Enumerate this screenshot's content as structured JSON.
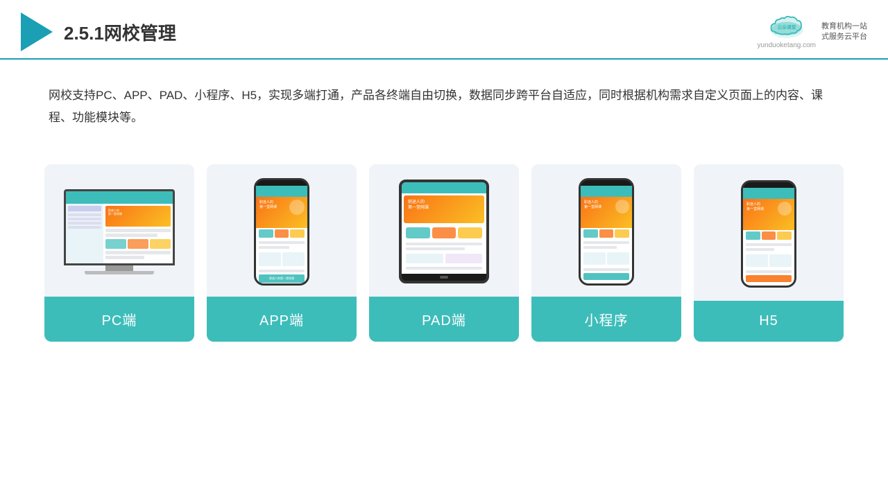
{
  "header": {
    "title": "2.5.1网校管理",
    "logo_text_line1": "教育机构一站",
    "logo_text_line2": "式服务云平台",
    "logo_url": "yunduoketang.com",
    "logo_name": "云朵课堂"
  },
  "description": {
    "text": "网校支持PC、APP、PAD、小程序、H5，实现多端打通，产品各终端自由切换，数据同步跨平台自适应，同时根据机构需求自定义页面上的内容、课程、功能模块等。"
  },
  "cards": [
    {
      "id": "pc",
      "label": "PC端"
    },
    {
      "id": "app",
      "label": "APP端"
    },
    {
      "id": "pad",
      "label": "PAD端"
    },
    {
      "id": "miniapp",
      "label": "小程序"
    },
    {
      "id": "h5",
      "label": "H5"
    }
  ],
  "colors": {
    "accent": "#3dbdba",
    "header_border": "#1a9fb5",
    "play_icon": "#1a9fb5",
    "card_bg": "#f0f4f8"
  }
}
